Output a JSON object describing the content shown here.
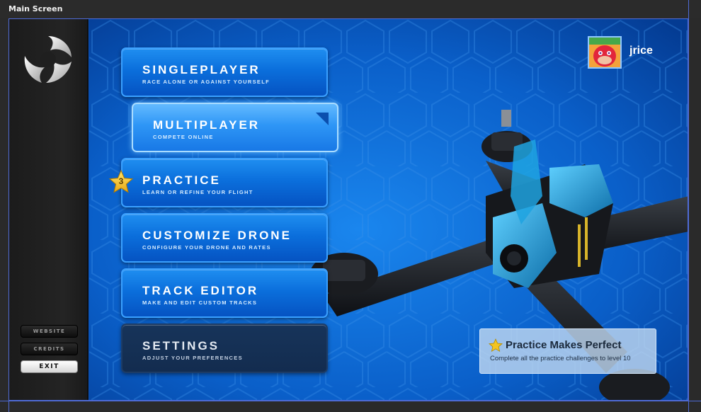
{
  "window": {
    "title": "Main Screen"
  },
  "sidebar": {
    "buttons": [
      {
        "label": "WEBSITE"
      },
      {
        "label": "CREDITS"
      },
      {
        "label": "EXIT"
      }
    ]
  },
  "menu": {
    "items": [
      {
        "label": "SINGLEPLAYER",
        "sub": "RACE ALONE OR AGAINST YOURSELF"
      },
      {
        "label": "MULTIPLAYER",
        "sub": "COMPETE ONLINE"
      },
      {
        "label": "PRACTICE",
        "sub": "LEARN OR REFINE YOUR FLIGHT",
        "badge": "3"
      },
      {
        "label": "CUSTOMIZE DRONE",
        "sub": "CONFIGURE YOUR DRONE AND RATES"
      },
      {
        "label": "TRACK EDITOR",
        "sub": "MAKE AND EDIT CUSTOM TRACKS"
      },
      {
        "label": "SETTINGS",
        "sub": "ADJUST YOUR PREFERENCES"
      }
    ]
  },
  "user": {
    "name": "jrice"
  },
  "toast": {
    "title": "Practice Makes Perfect",
    "description": "Complete all the practice challenges to level 10",
    "icon": "star-icon"
  },
  "colors": {
    "accent": "#0b6fdc",
    "active": "#2e96f6",
    "background": "#0a4fb6",
    "drone_highlight": "#1ea3e0"
  }
}
